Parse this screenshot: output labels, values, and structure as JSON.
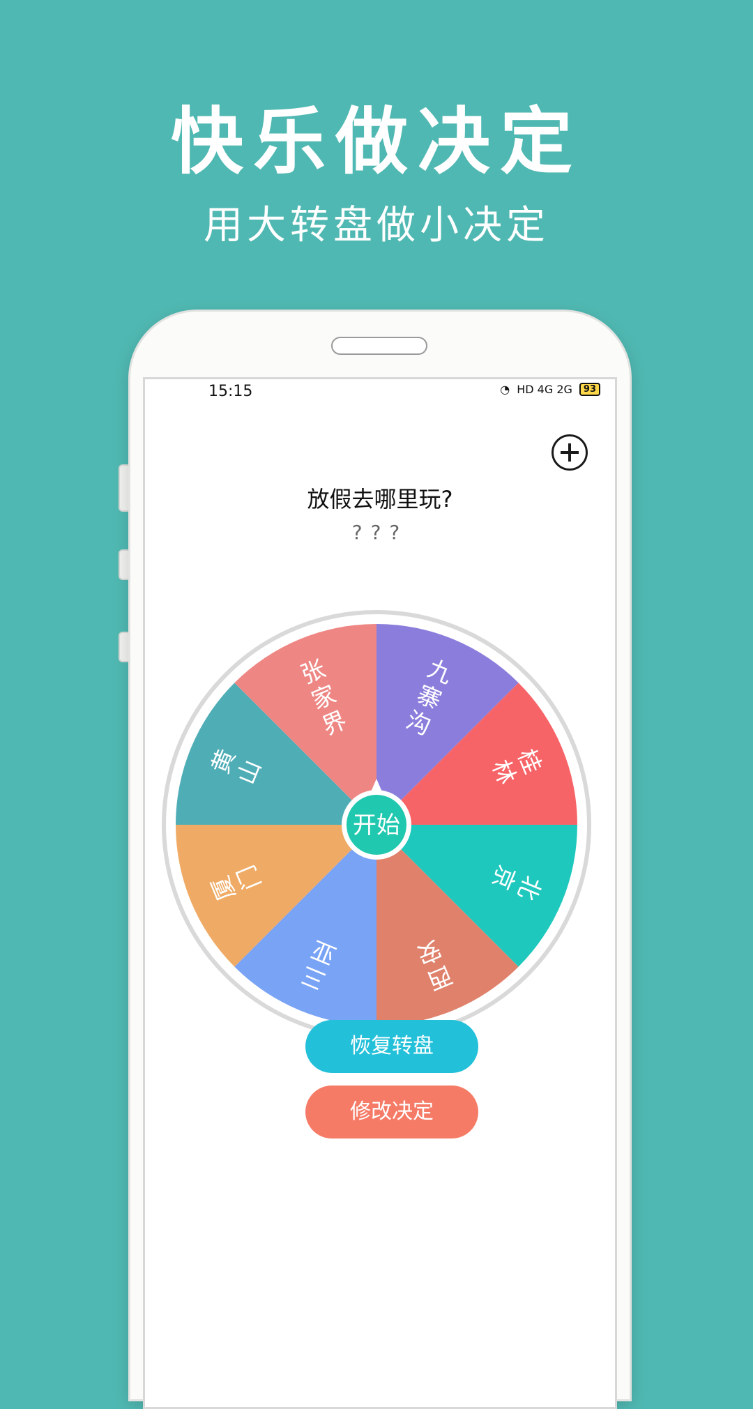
{
  "promo": {
    "title": "快乐做决定",
    "subtitle": "用大转盘做小决定"
  },
  "status_bar": {
    "time": "15:15",
    "network": "HD  4G  2G",
    "battery": "93"
  },
  "question": {
    "title": "放假去哪里玩?",
    "answer": "???"
  },
  "wheel": {
    "center_label": "开始",
    "colors": {
      "center": "#1fc8ae",
      "rim": "#d9d9d9"
    },
    "segments": [
      {
        "label": "九寨沟",
        "color": "#8a7ddc"
      },
      {
        "label": "桂林",
        "color": "#f76468"
      },
      {
        "label": "北京",
        "color": "#1fc8bd"
      },
      {
        "label": "西安",
        "color": "#df816b"
      },
      {
        "label": "三亚",
        "color": "#79a3f5"
      },
      {
        "label": "厦门",
        "color": "#efab66"
      },
      {
        "label": "黄山",
        "color": "#4fadb6"
      },
      {
        "label": "张家界",
        "color": "#ee8784"
      }
    ]
  },
  "buttons": {
    "restore": "恢复转盘",
    "modify": "修改决定"
  }
}
